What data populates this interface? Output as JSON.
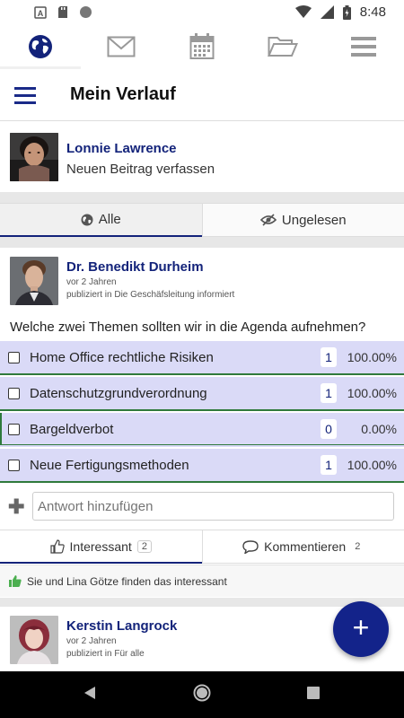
{
  "status_bar": {
    "time": "8:48",
    "left_icons": [
      "a-notification-icon",
      "sd-card-icon",
      "circle-icon"
    ],
    "right_icons": [
      "wifi-icon",
      "signal-icon",
      "battery-icon"
    ]
  },
  "top_nav": {
    "tabs": [
      {
        "icon": "globe-icon",
        "active": true
      },
      {
        "icon": "mail-icon",
        "active": false
      },
      {
        "icon": "calendar-icon",
        "active": false
      },
      {
        "icon": "folder-icon",
        "active": false
      },
      {
        "icon": "menu-icon",
        "active": false
      }
    ]
  },
  "header": {
    "title": "Mein Verlauf"
  },
  "composer": {
    "user_name": "Lonnie Lawrence",
    "prompt": "Neuen Beitrag verfassen"
  },
  "filter": {
    "tabs": [
      {
        "label": "Alle",
        "icon": "globe-icon",
        "active": true
      },
      {
        "label": "Ungelesen",
        "icon": "eye-slash-icon",
        "active": false
      }
    ]
  },
  "post": {
    "author": "Dr. Benedikt Durheim",
    "time": "vor 2 Jahren",
    "published": "publiziert in Die Geschäfsleitung informiert",
    "question": "Welche zwei Themen sollten wir in die Agenda aufnehmen?",
    "options": [
      {
        "label": "Home Office rechtliche Risiken",
        "count": "1",
        "percent": "100.00%",
        "value": 100
      },
      {
        "label": "Datenschutzgrundverordnung",
        "count": "1",
        "percent": "100.00%",
        "value": 100
      },
      {
        "label": "Bargeldverbot",
        "count": "0",
        "percent": "0.00%",
        "value": 0
      },
      {
        "label": "Neue Fertigungsmethoden",
        "count": "1",
        "percent": "100.00%",
        "value": 100
      }
    ],
    "reply_placeholder": "Antwort hinzufügen",
    "actions": {
      "like_label": "Interessant",
      "like_count": "2",
      "comment_label": "Kommentieren",
      "comment_count": "2"
    },
    "liked_text": "Sie und Lina Götze finden das interessant"
  },
  "post2": {
    "author": "Kerstin Langrock",
    "time": "vor 2 Jahren",
    "published": "publiziert in Für alle"
  },
  "fab": {
    "label": "+"
  },
  "colors": {
    "accent": "#13237a",
    "option_bg": "#dadaf7",
    "option_bar": "#2f7a3c",
    "fab": "#13238a"
  }
}
